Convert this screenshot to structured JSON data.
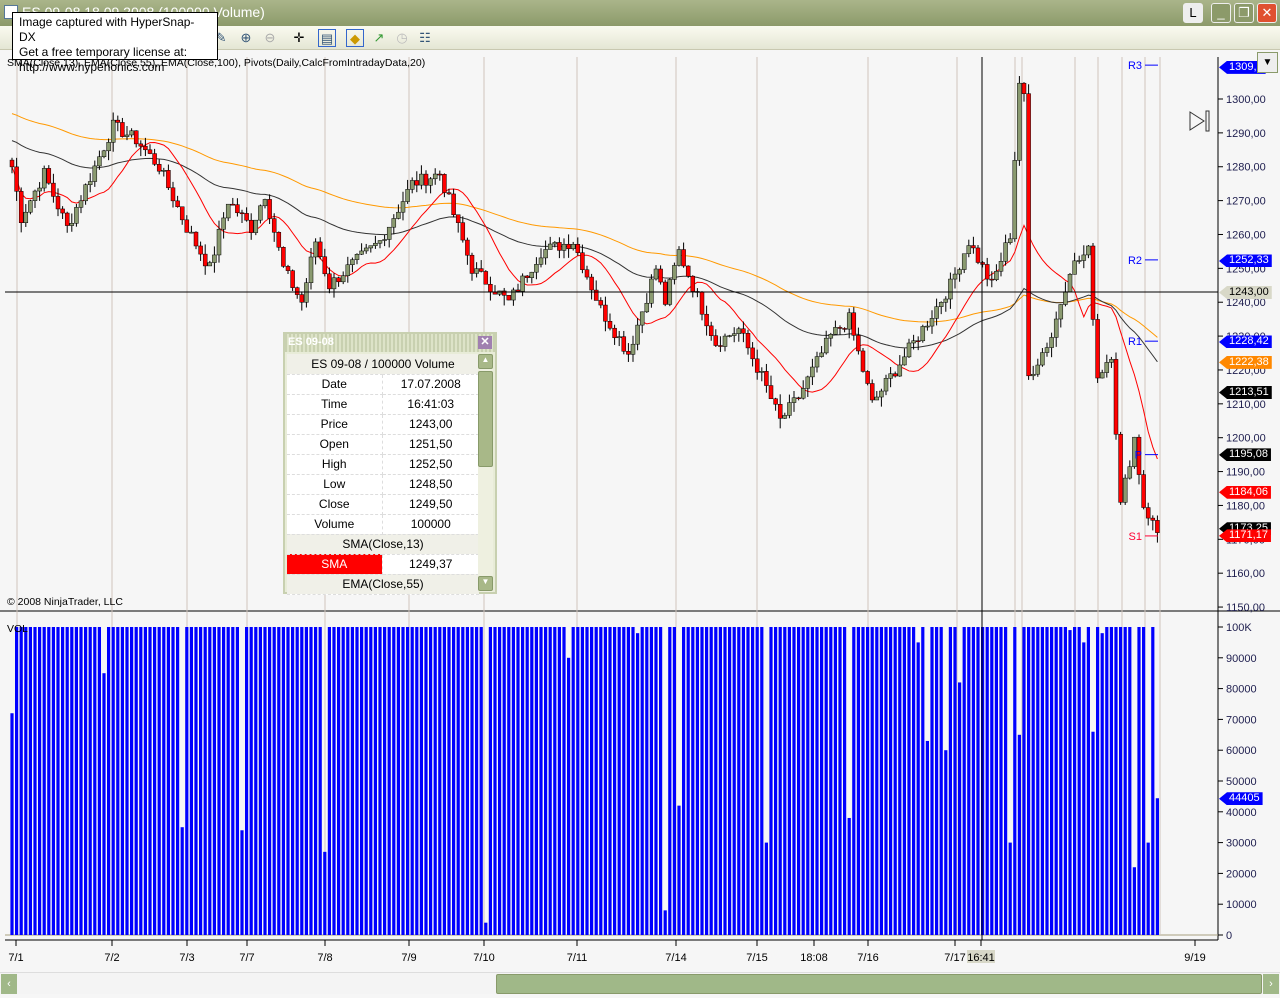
{
  "window": {
    "title": "ES 09-08  18.09.2008 (100000 Volume)",
    "buttons": [
      "L",
      "_",
      "❐",
      "✕"
    ]
  },
  "tooltip": {
    "lines": [
      "Image captured with HyperSnap-DX",
      "Get a free temporary license at:",
      "http://www.hyperionics.com"
    ]
  },
  "toolbar": {
    "icons": [
      "draw-icon",
      "zoom-in-icon",
      "zoom-out-icon",
      "crosshair-icon",
      "data-box-icon",
      "strategy-icon",
      "indicator-icon",
      "clock-icon",
      "properties-icon"
    ]
  },
  "indicators_label": "SMA(Close,13), EMA(Close,55), EMA(Close,100), Pivots(Daily,CalcFromIntradayData,20)",
  "copyright": "© 2008 NinjaTrader, LLC",
  "volume_label": "VOL",
  "colors": {
    "up": "#8a9a70",
    "down": "#ff0000",
    "sma": "#ff0000",
    "ema55": "#333333",
    "ema100": "#ff9900",
    "volume": "#0000ff"
  },
  "chart_data": {
    "type": "candlestick",
    "price_axis": {
      "ticks": [
        "1300,00",
        "1290,00",
        "1280,00",
        "1270,00",
        "1260,00",
        "1250,00",
        "1240,00",
        "1230,00",
        "1220,00",
        "1210,00",
        "1200,00",
        "1190,00",
        "1180,00",
        "1170,00",
        "1160,00",
        "1150,00"
      ],
      "range": [
        1150,
        1310
      ]
    },
    "volume_axis": {
      "ticks": [
        "100K",
        "90000",
        "80000",
        "70000",
        "60000",
        "50000",
        "40000",
        "30000",
        "20000",
        "10000",
        "0"
      ],
      "range": [
        0,
        100000
      ]
    },
    "time_labels": [
      "7/1",
      "7/2",
      "7/3",
      "7/7",
      "7/8",
      "7/9",
      "7/10",
      "7/11",
      "7/14",
      "7/15",
      "18:08",
      "7/16",
      "7/17",
      "16:41",
      "9/19"
    ],
    "bar_count": 250,
    "close_waypoints": [
      [
        0,
        1280
      ],
      [
        2,
        1265
      ],
      [
        7,
        1278
      ],
      [
        12,
        1262
      ],
      [
        22,
        1292
      ],
      [
        27,
        1288
      ],
      [
        32,
        1280
      ],
      [
        38,
        1262
      ],
      [
        43,
        1250
      ],
      [
        47,
        1270
      ],
      [
        52,
        1262
      ],
      [
        55,
        1272
      ],
      [
        59,
        1250
      ],
      [
        63,
        1240
      ],
      [
        66,
        1258
      ],
      [
        69,
        1245
      ],
      [
        73,
        1250
      ],
      [
        80,
        1258
      ],
      [
        87,
        1275
      ],
      [
        93,
        1278
      ],
      [
        100,
        1250
      ],
      [
        104,
        1245
      ],
      [
        108,
        1240
      ],
      [
        115,
        1255
      ],
      [
        122,
        1258
      ],
      [
        128,
        1238
      ],
      [
        134,
        1225
      ],
      [
        140,
        1250
      ],
      [
        142,
        1240
      ],
      [
        145,
        1255
      ],
      [
        153,
        1228
      ],
      [
        158,
        1232
      ],
      [
        163,
        1218
      ],
      [
        167,
        1205
      ],
      [
        171,
        1212
      ],
      [
        178,
        1230
      ],
      [
        182,
        1235
      ],
      [
        187,
        1210
      ],
      [
        191,
        1218
      ],
      [
        197,
        1230
      ],
      [
        204,
        1245
      ],
      [
        208,
        1258
      ],
      [
        213,
        1245
      ],
      [
        217,
        1260
      ],
      [
        219,
        1305
      ],
      [
        220,
        1300
      ],
      [
        221,
        1218
      ],
      [
        226,
        1230
      ],
      [
        230,
        1250
      ],
      [
        234,
        1255
      ],
      [
        236,
        1218
      ],
      [
        239,
        1225
      ],
      [
        241,
        1180
      ],
      [
        244,
        1200
      ],
      [
        246,
        1180
      ],
      [
        249,
        1172
      ]
    ],
    "volume_dips": [
      [
        0,
        72000
      ],
      [
        20,
        85000
      ],
      [
        37,
        35000
      ],
      [
        50,
        34000
      ],
      [
        68,
        27000
      ],
      [
        103,
        4000
      ],
      [
        121,
        90000
      ],
      [
        136,
        98000
      ],
      [
        142,
        8000
      ],
      [
        145,
        42000
      ],
      [
        164,
        30000
      ],
      [
        182,
        38000
      ],
      [
        197,
        95000
      ],
      [
        199,
        63000
      ],
      [
        203,
        60000
      ],
      [
        206,
        82000
      ],
      [
        217,
        30000
      ],
      [
        219,
        65000
      ],
      [
        230,
        99000
      ],
      [
        233,
        95000
      ],
      [
        235,
        66000
      ],
      [
        237,
        98000
      ],
      [
        244,
        22000
      ],
      [
        247,
        30000
      ],
      [
        249,
        44405
      ]
    ],
    "pivots": [
      {
        "label": "R3",
        "value": 1310
      },
      {
        "label": "R2",
        "value": 1252.5
      },
      {
        "label": "R1",
        "value": 1228.5
      },
      {
        "label": "P",
        "value": 1195
      },
      {
        "label": "S1",
        "value": 1171
      }
    ],
    "price_markers": [
      {
        "value": "1309,5",
        "color": "#0000ff"
      },
      {
        "value": "1252,33",
        "color": "#0000ff"
      },
      {
        "value": "1243,00",
        "color": "#d8d8c8"
      },
      {
        "value": "1228,42",
        "color": "#0000ff"
      },
      {
        "value": "1222,38",
        "color": "#ff8800"
      },
      {
        "value": "1213,51",
        "color": "#000000"
      },
      {
        "value": "1195,08",
        "color": "#000000"
      },
      {
        "value": "1184,06",
        "color": "#ff0000"
      },
      {
        "value": "1173,25",
        "color": "#000000"
      },
      {
        "value": "1171,17",
        "color": "#ff0000"
      }
    ],
    "volume_marker": "44405",
    "crosshair": {
      "price": 1243,
      "time": "16:41"
    }
  },
  "databox": {
    "title": "ES 09-08",
    "header": "ES 09-08 / 100000 Volume",
    "rows": [
      [
        "Date",
        "17.07.2008"
      ],
      [
        "Time",
        "16:41:03"
      ],
      [
        "Price",
        "1243,00"
      ],
      [
        "Open",
        "1251,50"
      ],
      [
        "High",
        "1252,50"
      ],
      [
        "Low",
        "1248,50"
      ],
      [
        "Close",
        "1249,50"
      ],
      [
        "Volume",
        "100000"
      ]
    ],
    "section1": "SMA(Close,13)",
    "sma_label": "SMA",
    "sma_value": "1249,37",
    "section2": "EMA(Close,55)"
  }
}
